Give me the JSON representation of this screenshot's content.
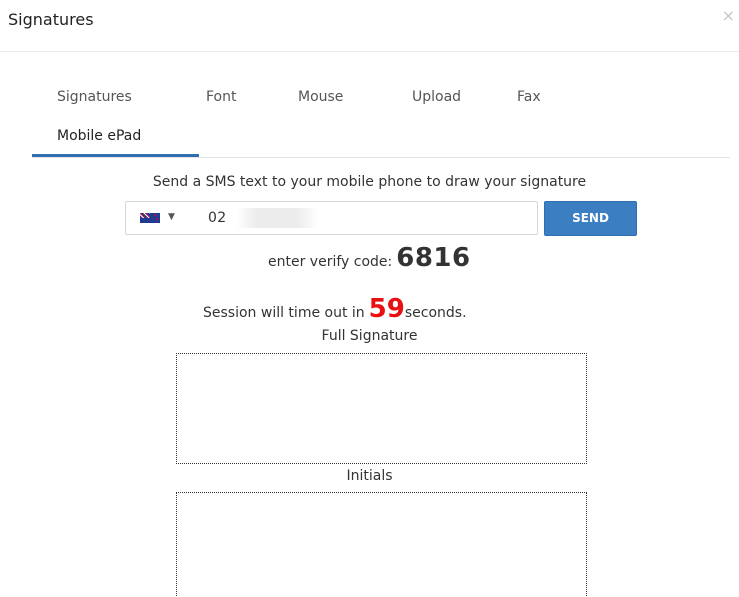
{
  "dialog": {
    "title": "Signatures",
    "close_symbol": "×"
  },
  "tabs": [
    {
      "label": "Signatures"
    },
    {
      "label": "Font"
    },
    {
      "label": "Mouse"
    },
    {
      "label": "Upload"
    },
    {
      "label": "Fax"
    },
    {
      "label": "Mobile ePad",
      "active": true
    }
  ],
  "mobile": {
    "instruction": "Send a SMS text to your mobile phone to draw your signature",
    "country_flag": "new-zealand-flag-icon",
    "phone_value": "02          6",
    "send_label": "SEND",
    "verify_label": "enter verify code:",
    "verify_code": "6816",
    "timeout_prefix": "Session will time out in",
    "timeout_seconds": "59",
    "timeout_suffix": "seconds."
  },
  "pads": {
    "full_signature_label": "Full Signature",
    "initials_label": "Initials"
  },
  "colors": {
    "accent": "#2f6fb0",
    "send_button": "#3b7ec2",
    "countdown": "#e81010"
  }
}
